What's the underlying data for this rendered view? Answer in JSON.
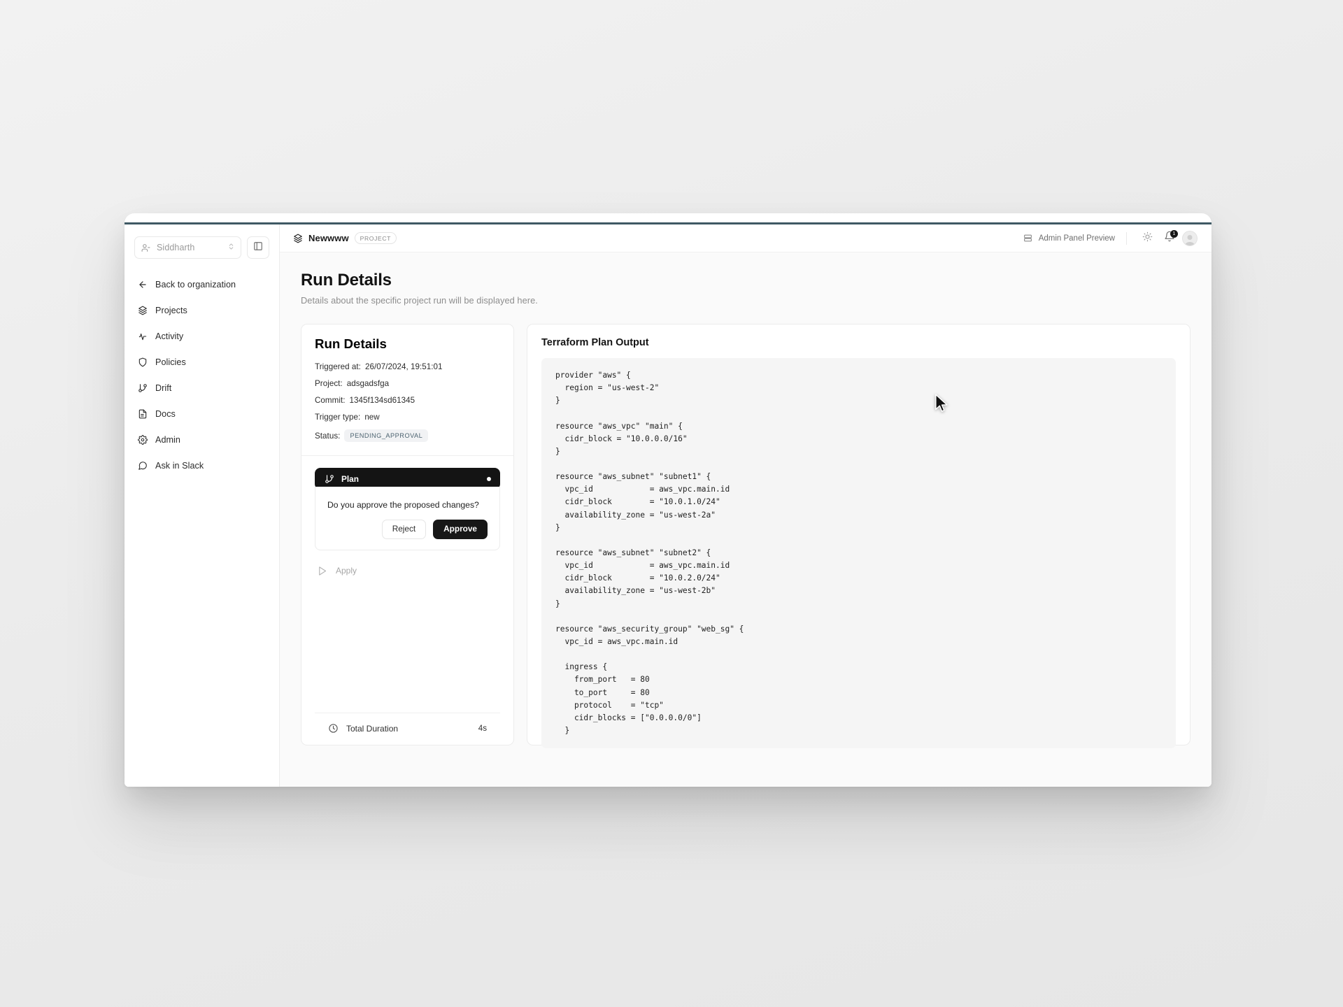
{
  "sidebar": {
    "org_selector": {
      "value": "Siddharth",
      "icon": "user-icon"
    },
    "panel_toggle_icon": "panel-left-icon",
    "items": [
      {
        "label": "Back to organization",
        "icon": "arrow-left-icon"
      },
      {
        "label": "Projects",
        "icon": "layers-icon"
      },
      {
        "label": "Activity",
        "icon": "activity-pulse-icon"
      },
      {
        "label": "Policies",
        "icon": "shield-icon"
      },
      {
        "label": "Drift",
        "icon": "git-branch-icon"
      },
      {
        "label": "Docs",
        "icon": "file-text-icon"
      },
      {
        "label": "Admin",
        "icon": "gear-icon"
      },
      {
        "label": "Ask in Slack",
        "icon": "message-circle-icon"
      }
    ]
  },
  "topbar": {
    "project_icon": "layers-icon",
    "project_name": "Newwww",
    "project_chip": "PROJECT",
    "admin_link": "Admin Panel Preview",
    "admin_link_icon": "panel-rows-icon",
    "theme_icon": "sun-icon",
    "bell_icon": "bell-icon",
    "bell_count": "1",
    "avatar": "avatar"
  },
  "page": {
    "title": "Run Details",
    "subtitle": "Details about the specific project run will be displayed here."
  },
  "run_details": {
    "heading": "Run Details",
    "fields": [
      {
        "label": "Triggered at:",
        "value": "26/07/2024, 19:51:01"
      },
      {
        "label": "Project:",
        "value": "adsgadsfga"
      },
      {
        "label": "Commit:",
        "value": "1345f134sd61345"
      },
      {
        "label": "Trigger type:",
        "value": "new"
      }
    ],
    "status_label": "Status:",
    "status_value": "PENDING_APPROVAL",
    "status_color": "#4c6370",
    "status_bg": "#f1f2f4"
  },
  "stage": {
    "name": "Plan",
    "icon": "git-branch-icon",
    "status_dot_color": "#ffffff",
    "question": "Do you approve the proposed changes?",
    "reject_label": "Reject",
    "approve_label": "Approve",
    "apply_label": "Apply",
    "apply_icon": "play-icon"
  },
  "duration": {
    "icon": "clock-icon",
    "label": "Total Duration",
    "value": "4s"
  },
  "terraform": {
    "title": "Terraform Plan Output",
    "code": "provider \"aws\" {\n  region = \"us-west-2\"\n}\n\nresource \"aws_vpc\" \"main\" {\n  cidr_block = \"10.0.0.0/16\"\n}\n\nresource \"aws_subnet\" \"subnet1\" {\n  vpc_id            = aws_vpc.main.id\n  cidr_block        = \"10.0.1.0/24\"\n  availability_zone = \"us-west-2a\"\n}\n\nresource \"aws_subnet\" \"subnet2\" {\n  vpc_id            = aws_vpc.main.id\n  cidr_block        = \"10.0.2.0/24\"\n  availability_zone = \"us-west-2b\"\n}\n\nresource \"aws_security_group\" \"web_sg\" {\n  vpc_id = aws_vpc.main.id\n\n  ingress {\n    from_port   = 80\n    to_port     = 80\n    protocol    = \"tcp\"\n    cidr_blocks = [\"0.0.0.0/0\"]\n  }"
  },
  "theme": {
    "accent_line": "#3f5964",
    "dark": "#171717",
    "page_bg": "#ededed"
  }
}
